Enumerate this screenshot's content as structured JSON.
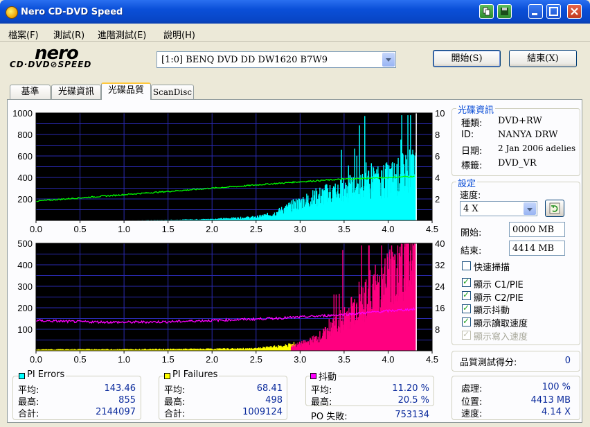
{
  "window": {
    "title": "Nero CD-DVD Speed"
  },
  "menu": [
    "檔案(F)",
    "測試(R)",
    "進階測試(E)",
    "說明(H)"
  ],
  "logo": {
    "brand": "nero",
    "product": "CD·DVD⊘SPEED"
  },
  "drive": {
    "selected": "[1:0]   BENQ DVD DD DW1620 B7W9"
  },
  "buttons": {
    "start": "開始(S)",
    "exit": "結束(X)"
  },
  "tabs": [
    {
      "label": "基準",
      "active": false
    },
    {
      "label": "光碟資訊",
      "active": false
    },
    {
      "label": "光碟品質",
      "active": true
    },
    {
      "label": "ScanDisc",
      "active": false
    }
  ],
  "disc_info": {
    "title": "光碟資訊",
    "type_label": "種類:",
    "type": "DVD+RW",
    "id_label": "ID:",
    "id": "NANYA DRW",
    "date_label": "日期:",
    "date": "2 Jan 2006  adelies",
    "label_label": "標籤:",
    "label": "DVD_VR"
  },
  "settings": {
    "title": "設定",
    "speed_label": "速度:",
    "speed": "4 X",
    "start_label": "開始:",
    "start": "0000 MB",
    "end_label": "結束:",
    "end": "4414 MB",
    "options": [
      {
        "label": "快速掃描",
        "checked": false,
        "enabled": true
      },
      {
        "label": "顯示 C1/PIE",
        "checked": true,
        "enabled": true
      },
      {
        "label": "顯示 C2/PIE",
        "checked": true,
        "enabled": true
      },
      {
        "label": "顯示抖動",
        "checked": true,
        "enabled": true
      },
      {
        "label": "顯示讀取速度",
        "checked": true,
        "enabled": true
      },
      {
        "label": "顯示寫入速度",
        "checked": true,
        "enabled": false
      }
    ]
  },
  "quality": {
    "label": "品質測試得分:",
    "score": "0"
  },
  "progress": {
    "process_label": "處理:",
    "process": "100 %",
    "position_label": "位置:",
    "position": "4413 MB",
    "speed_label": "速度:",
    "speed": "4.14 X"
  },
  "stats": {
    "pie": {
      "title": "PI Errors",
      "color": "#00ffff",
      "avg_label": "平均:",
      "avg": "143.46",
      "max_label": "最高:",
      "max": "855",
      "total_label": "合計:",
      "total": "2144097"
    },
    "pif": {
      "title": "PI Failures",
      "color": "#ffff00",
      "avg_label": "平均:",
      "avg": "68.41",
      "max_label": "最高:",
      "max": "498",
      "total_label": "合計:",
      "total": "1009124"
    },
    "jitter": {
      "title": "抖動",
      "color": "#ff00ff",
      "avg_label": "平均:",
      "avg": "11.20 %",
      "max_label": "最高:",
      "max": "20.5 %",
      "po_label": "PO 失敗:",
      "po": "753134"
    }
  },
  "chart_data": [
    {
      "type": "area",
      "name": "PI Errors + Read Speed",
      "x_ticks": [
        "0.0",
        "0.5",
        "1.0",
        "1.5",
        "2.0",
        "2.5",
        "3.0",
        "3.5",
        "4.0",
        "4.5"
      ],
      "xlim": [
        0,
        4.5
      ],
      "y_ticks_left": [
        "1000",
        "800",
        "600",
        "400",
        "200"
      ],
      "ylim_left": [
        0,
        1000
      ],
      "y_ticks_right": [
        "10",
        "8",
        "6",
        "4",
        "2"
      ],
      "ylim_right": [
        0,
        10
      ],
      "series": [
        {
          "color": "#00ffff",
          "x": [
            0,
            0.5,
            1.0,
            1.5,
            2.0,
            2.5,
            2.7,
            2.9,
            3.1,
            3.3,
            3.5,
            3.7,
            3.9,
            4.1,
            4.25,
            4.32
          ],
          "values": [
            0,
            0,
            2,
            5,
            12,
            30,
            60,
            130,
            190,
            240,
            280,
            320,
            360,
            400,
            480,
            500
          ]
        },
        {
          "color": "#00ff00",
          "x": [
            0,
            0.5,
            1.0,
            1.5,
            2.0,
            2.5,
            3.0,
            3.5,
            4.0,
            4.3
          ],
          "values": [
            1.8,
            2.1,
            2.4,
            2.7,
            3.0,
            3.3,
            3.6,
            3.85,
            4.0,
            4.1
          ]
        }
      ],
      "grid": true
    },
    {
      "type": "area",
      "name": "PI Failures + Jitter",
      "x_ticks": [
        "0.0",
        "0.5",
        "1.0",
        "1.5",
        "2.0",
        "2.5",
        "3.0",
        "3.5",
        "4.0",
        "4.5"
      ],
      "xlim": [
        0,
        4.5
      ],
      "y_ticks_left": [
        "500",
        "400",
        "300",
        "200",
        "100"
      ],
      "ylim_left": [
        0,
        500
      ],
      "y_ticks_right": [
        "40",
        "32",
        "24",
        "16",
        "8"
      ],
      "ylim_right": [
        0,
        40
      ],
      "series": [
        {
          "color": "#ffff00",
          "x": [
            0,
            0.5,
            1.0,
            1.5,
            2.0,
            2.5,
            2.8,
            2.95
          ],
          "values": [
            5,
            6,
            6,
            7,
            8,
            10,
            20,
            30
          ]
        },
        {
          "color": "#ff0080",
          "x": [
            2.9,
            3.1,
            3.3,
            3.5,
            3.7,
            3.9,
            4.1,
            4.25,
            4.32
          ],
          "values": [
            20,
            40,
            80,
            150,
            230,
            300,
            380,
            420,
            470
          ]
        },
        {
          "color": "#ff00ff",
          "x": [
            0,
            0.5,
            1.0,
            1.5,
            2.0,
            2.5,
            3.0,
            3.5,
            4.0,
            4.3
          ],
          "values": [
            11.2,
            10.8,
            10.6,
            10.8,
            11.3,
            11.8,
            12.5,
            13.5,
            14.8,
            15.5
          ]
        }
      ],
      "grid": true
    }
  ]
}
